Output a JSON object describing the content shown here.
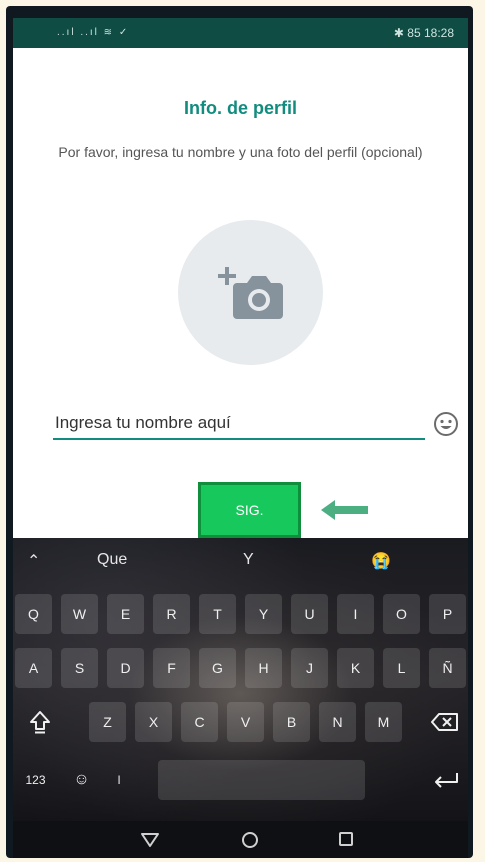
{
  "status_bar": {
    "time": "18:28",
    "battery": "85",
    "signal": "..ıl ..ıl ≋ ✓"
  },
  "profile": {
    "title": "Info. de perfil",
    "subtitle": "Por favor, ingresa tu nombre y una foto del perfil (opcional)",
    "name_placeholder": "Ingresa tu nombre aquí",
    "name_value": "",
    "next_label": "SIG.",
    "photo_icon": "add-camera-icon",
    "emoji_icon": "smiley-icon"
  },
  "keyboard": {
    "suggestions": [
      "Que",
      "Y",
      "😭"
    ],
    "row1": [
      "Q",
      "W",
      "E",
      "R",
      "T",
      "Y",
      "U",
      "I",
      "O",
      "P"
    ],
    "row2": [
      "A",
      "S",
      "D",
      "F",
      "G",
      "H",
      "J",
      "K",
      "L",
      "Ñ"
    ],
    "row3": [
      "Z",
      "X",
      "C",
      "V",
      "B",
      "N",
      "M"
    ],
    "numbers_label": "123",
    "shift_icon": "shift-icon",
    "backspace_icon": "backspace-icon",
    "enter_icon": "enter-icon"
  },
  "nav": {
    "back_icon": "back-triangle-icon",
    "home_icon": "home-circle-icon",
    "recents_icon": "recents-square-icon"
  },
  "colors": {
    "accent": "#128c7e",
    "button": "#17c95d",
    "arrow": "#4caf82",
    "statusbar": "#0e4c44"
  }
}
